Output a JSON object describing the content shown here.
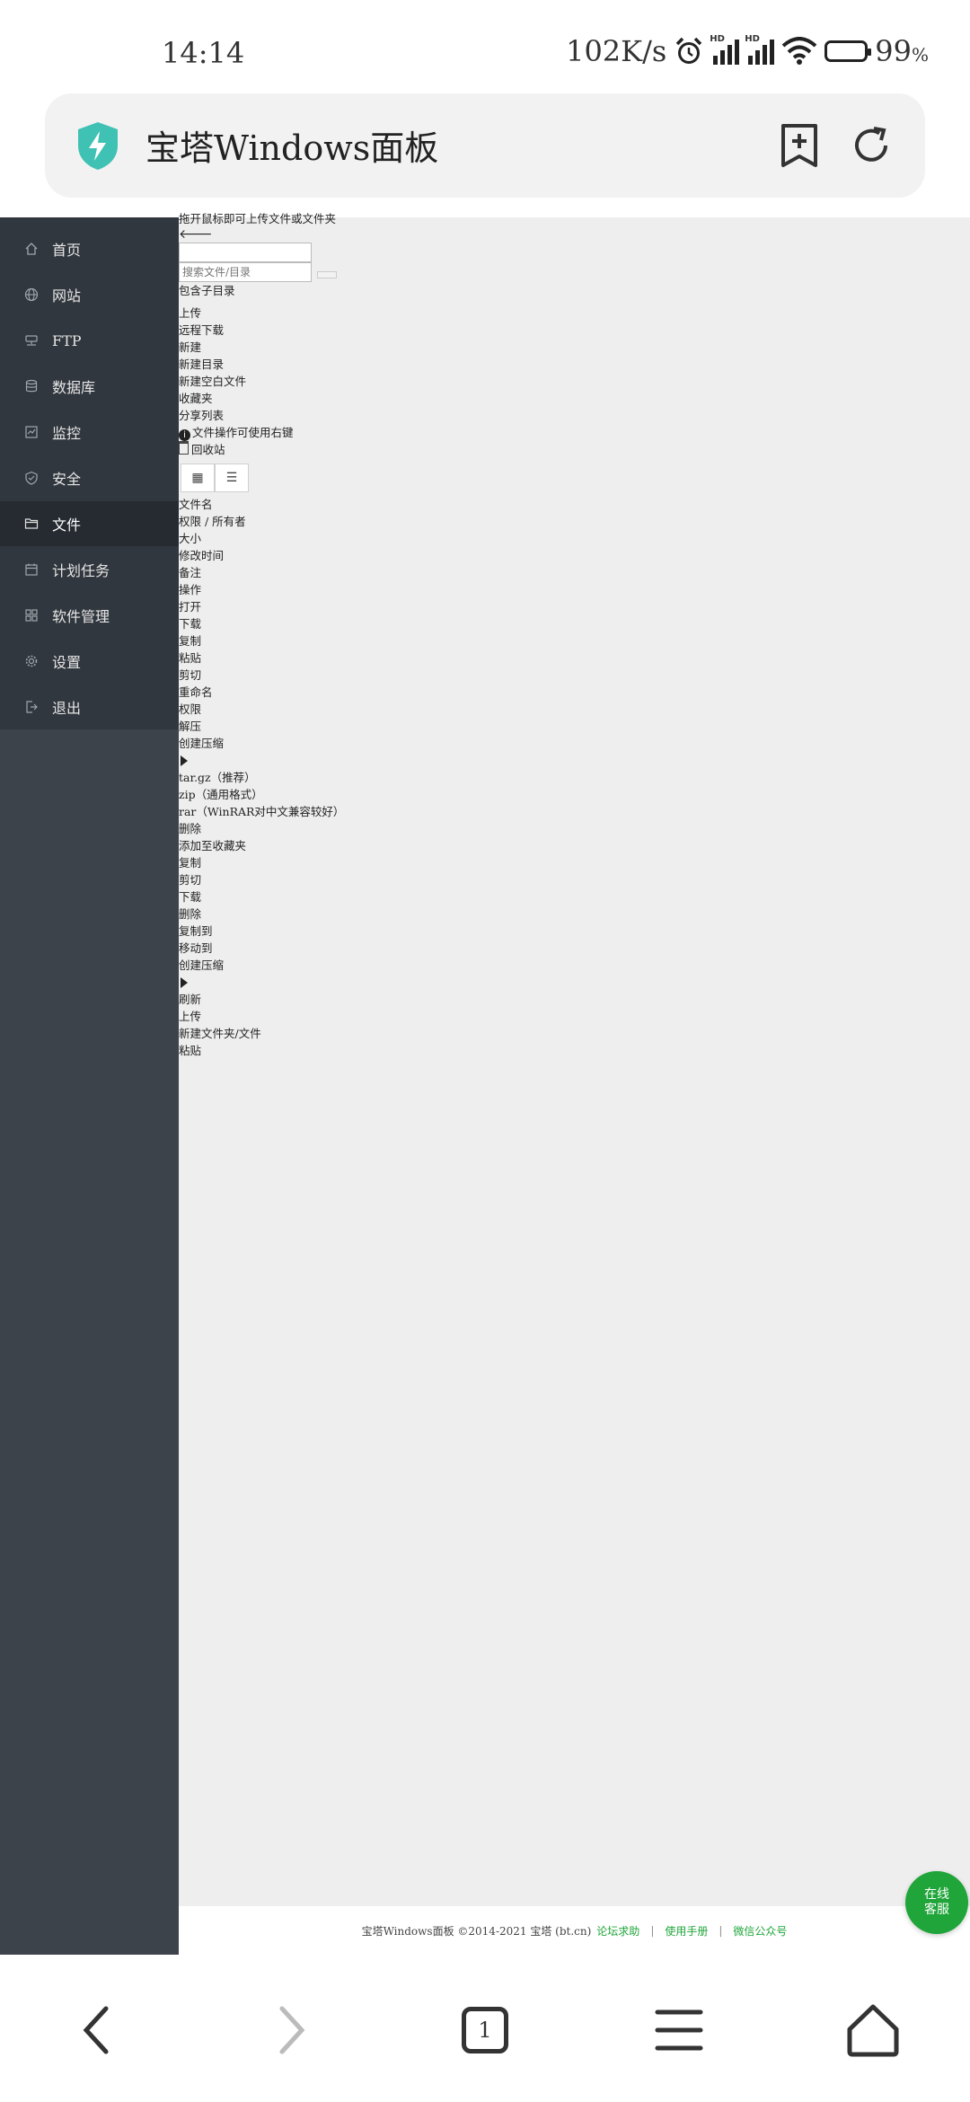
{
  "status_bar": {
    "time": "14:14",
    "net_speed": "102K/s",
    "battery_value": "99",
    "battery_unit": "%",
    "battery_level": 0.99,
    "icons": [
      "alarm-icon",
      "hd-signal-icon",
      "hd-signal-icon",
      "wifi-icon",
      "battery-icon"
    ]
  },
  "browser": {
    "page_title": "宝塔Windows面板",
    "tab_count": "1",
    "accent": "#3fc1b4"
  },
  "sidebar": {
    "items": [
      {
        "label": "首页",
        "icon": "home-icon"
      },
      {
        "label": "网站",
        "icon": "globe-icon"
      },
      {
        "label": "FTP",
        "icon": "ftp-icon"
      },
      {
        "label": "数据库",
        "icon": "database-icon"
      },
      {
        "label": "监控",
        "icon": "monitor-icon"
      },
      {
        "label": "安全",
        "icon": "shield-icon"
      },
      {
        "label": "文件",
        "icon": "folder-icon",
        "active": true
      },
      {
        "label": "计划任务",
        "icon": "calendar-icon"
      },
      {
        "label": "软件管理",
        "icon": "grid-icon"
      },
      {
        "label": "设置",
        "icon": "gear-icon"
      },
      {
        "label": "退出",
        "icon": "logout-icon"
      }
    ]
  },
  "files": {
    "drop_hint": "拖开鼠标即可上传文件或文件夹",
    "path_value": "",
    "search_placeholder": "搜索文件/目录",
    "include_subdir": "包含子目录",
    "upload": "上传",
    "remote_download": "远程下载",
    "new": "新建",
    "new_dir": "新建目录",
    "new_blank_file": "新建空白文件",
    "favorites": "收藏夹",
    "share_list": "分享列表",
    "right_click_tip": "文件操作可使用右键",
    "recycle_bin": "回收站",
    "columns": [
      "文件名",
      "权限 / 所有者",
      "大小",
      "修改时间",
      "备注",
      "操作"
    ],
    "row_menu": [
      "打开",
      "下载",
      "复制",
      "粘贴",
      "剪切",
      "重命名",
      "权限",
      "解压",
      "创建压缩"
    ],
    "compress_formats": [
      "tar.gz（推荐）",
      "zip（通用格式）",
      "rar（WinRAR对中文兼容较好）"
    ],
    "row_menu_after": [
      "删除",
      "添加至收藏夹"
    ],
    "batch_menu": [
      "复制",
      "剪切",
      "下载",
      "删除",
      "复制到",
      "移动到",
      "创建压缩"
    ],
    "blank_menu": [
      "刷新",
      "上传",
      "新建文件夹/文件",
      "粘贴"
    ]
  },
  "footer": {
    "copyright": "宝塔Windows面板 ©2014-2021 宝塔 (bt.cn)",
    "links": [
      "论坛求助",
      "使用手册",
      "微信公众号"
    ],
    "separator": "|",
    "link_color": "#20a53a"
  },
  "chat_button": {
    "line1": "在线",
    "line2": "客服",
    "color": "#20a53a"
  },
  "bottom_nav": {
    "icons": [
      "back-icon",
      "forward-icon",
      "tabs-icon",
      "menu-icon",
      "home-icon"
    ]
  }
}
